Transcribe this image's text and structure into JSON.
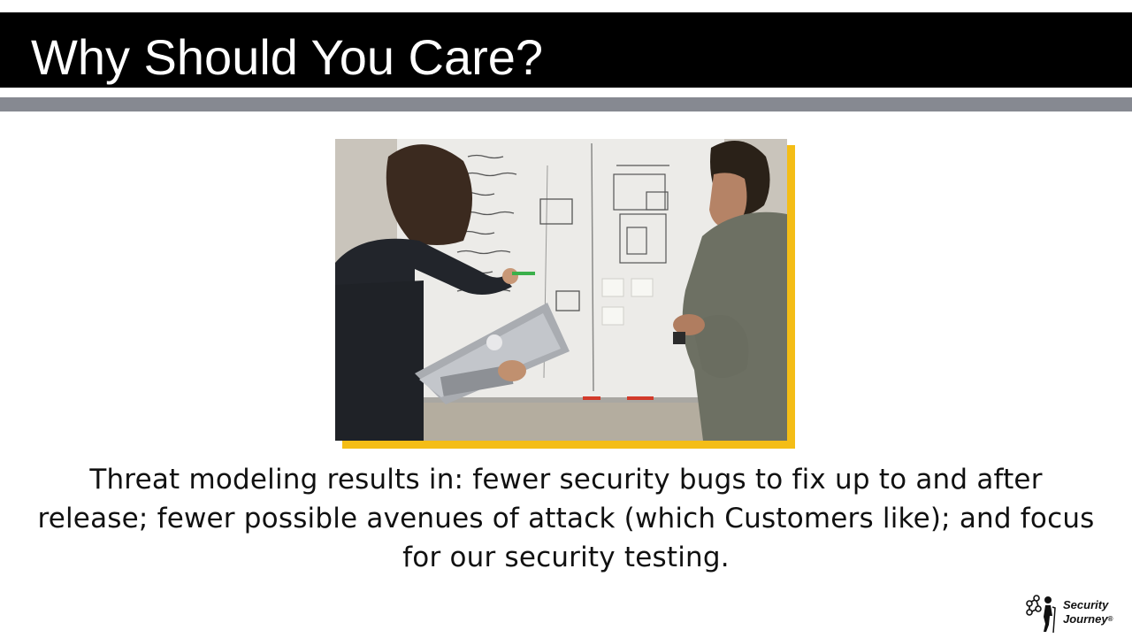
{
  "slide": {
    "title": "Why Should You Care?",
    "body": "Threat modeling results in: fewer security bugs to fix up to and after release; fewer possible avenues of attack (which Customers like); and focus for our security testing."
  },
  "photo": {
    "subject": "two-people-at-whiteboard-photo"
  },
  "logo": {
    "line1": "Security",
    "line2": "Journey",
    "mark": "®"
  },
  "colors": {
    "title_bar": "#000000",
    "title_text": "#ffffff",
    "rule": "#868991",
    "photo_accent": "#f4bd16",
    "body_text": "#111111"
  }
}
